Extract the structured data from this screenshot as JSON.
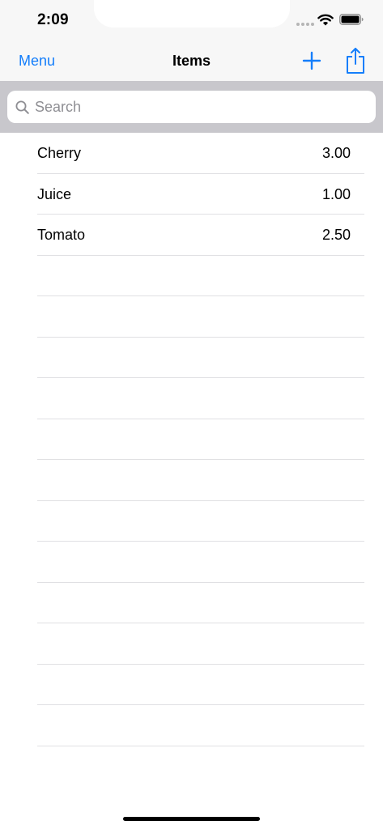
{
  "status_bar": {
    "time": "2:09"
  },
  "nav": {
    "left_label": "Menu",
    "title": "Items",
    "add_icon": "plus-icon",
    "share_icon": "share-icon"
  },
  "search": {
    "placeholder": "Search",
    "value": ""
  },
  "items": [
    {
      "name": "Cherry",
      "value": "3.00"
    },
    {
      "name": "Juice",
      "value": "1.00"
    },
    {
      "name": "Tomato",
      "value": "2.50"
    }
  ],
  "colors": {
    "accent": "#147efb",
    "search_bar_bg": "#c8c7cc",
    "nav_bg": "#f7f7f7"
  }
}
